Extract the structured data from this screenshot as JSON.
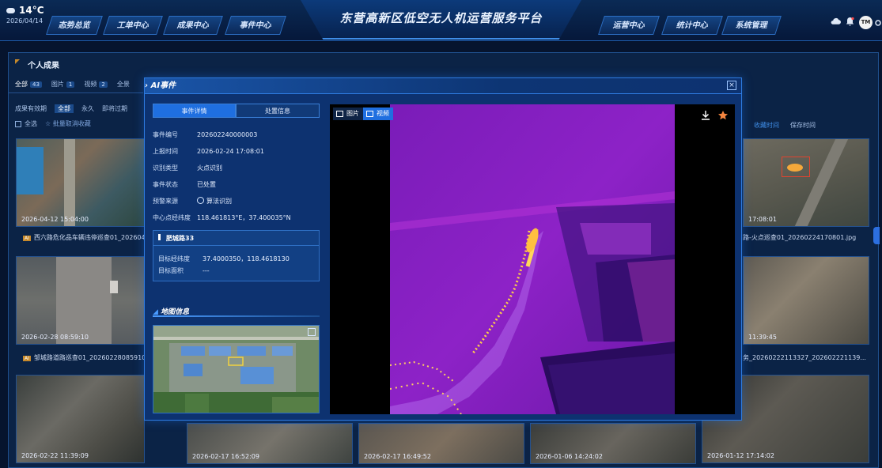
{
  "header": {
    "weather": {
      "temperature": "14°C",
      "date": "2026/04/14",
      "icon": "cloud-icon"
    },
    "title": "东营高新区低空无人机运营服务平台",
    "nav_left": [
      "态势总览",
      "工单中心",
      "成果中心",
      "事件中心"
    ],
    "nav_right": [
      "运营中心",
      "统计中心",
      "系统管理"
    ],
    "user_initials": "TM",
    "icons": [
      "cloud-upload-icon",
      "bell-icon",
      "gear-icon"
    ]
  },
  "results_panel": {
    "title": "个人成果",
    "type_tabs": [
      {
        "label": "全部",
        "count": "43"
      },
      {
        "label": "图片",
        "count": "1"
      },
      {
        "label": "视频",
        "count": "2"
      },
      {
        "label": "全景",
        "count": ""
      }
    ],
    "validity_label": "成果有效期",
    "validity_tabs": [
      "全部",
      "永久",
      "即将过期"
    ],
    "select_all": "全选",
    "batch_unfavorite": "批量取消收藏",
    "sort_options": [
      "收藏时间",
      "保存时间"
    ],
    "left_thumbs": [
      {
        "timestamp": "2026-04-12 15:04:00",
        "caption": "西六路危化品车辆违停巡查01_202604"
      },
      {
        "timestamp": "2026-02-28 08:59:10",
        "caption": "邹城路道路巡查01_20260228085910."
      },
      {
        "timestamp": "2026-02-22 11:39:09",
        "caption": ""
      }
    ],
    "right_thumbs": [
      {
        "timestamp": "17:08:01",
        "caption": "路-火点巡查01_20260224170801.jpg"
      },
      {
        "timestamp": "11:39:45",
        "caption": "务_20260222113327_202602221139..."
      },
      {
        "timestamp": "2026-01-12 17:14:02",
        "caption": ""
      }
    ],
    "bottom_thumbs": [
      {
        "timestamp": "2026-02-17 16:52:09"
      },
      {
        "timestamp": "2026-02-17 16:49:52"
      },
      {
        "timestamp": "2026-01-06 14:24:02"
      }
    ],
    "ai_tag": "AI"
  },
  "modal": {
    "title": "AI事件",
    "tabs": [
      "事件详情",
      "处置信息"
    ],
    "fields": [
      {
        "label": "事件编号",
        "value": "202602240000003"
      },
      {
        "label": "上报时间",
        "value": "2026-02-24 17:08:01"
      },
      {
        "label": "识别类型",
        "value": "火点识别"
      },
      {
        "label": "事件状态",
        "value": "已处置"
      },
      {
        "label": "预警来源",
        "value": "算法识别"
      },
      {
        "label": "中心点经纬度",
        "value": "118.461813°E，37.400035°N"
      }
    ],
    "target": {
      "name": "肥城路33",
      "fields": [
        {
          "label": "目标经纬度",
          "value": "37.4000350，118.4618130"
        },
        {
          "label": "目标面积",
          "value": "---"
        }
      ]
    },
    "map_title": "地图信息",
    "viewer_tabs": [
      "图片",
      "视频"
    ],
    "viewer_icons": [
      "download-icon",
      "star-icon"
    ]
  },
  "colors": {
    "accent": "#2e7be0",
    "active_tab": "#1f6fe0",
    "fire": "#ffb43c",
    "thermal": "#8a1fc0"
  }
}
